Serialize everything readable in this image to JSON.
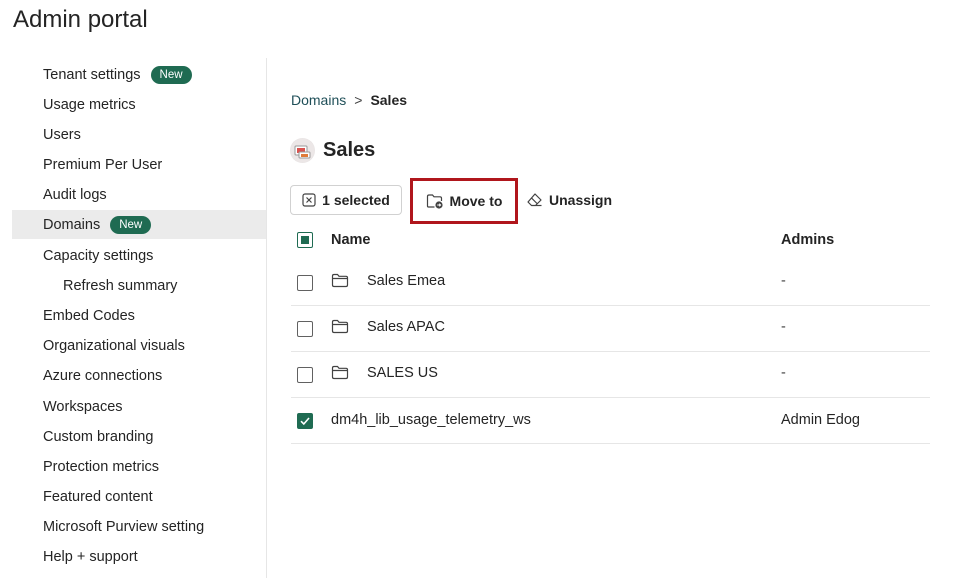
{
  "app": {
    "title": "Admin portal"
  },
  "sidebar": {
    "items": [
      {
        "label": "Tenant settings",
        "badge": "New"
      },
      {
        "label": "Usage metrics"
      },
      {
        "label": "Users"
      },
      {
        "label": "Premium Per User"
      },
      {
        "label": "Audit logs"
      },
      {
        "label": "Domains",
        "badge": "New",
        "active": true
      },
      {
        "label": "Capacity settings"
      },
      {
        "label": "Refresh summary",
        "sub": true
      },
      {
        "label": "Embed Codes"
      },
      {
        "label": "Organizational visuals"
      },
      {
        "label": "Azure connections"
      },
      {
        "label": "Workspaces"
      },
      {
        "label": "Custom branding"
      },
      {
        "label": "Protection metrics"
      },
      {
        "label": "Featured content"
      },
      {
        "label": "Microsoft Purview setting"
      },
      {
        "label": "Help + support"
      }
    ]
  },
  "breadcrumb": {
    "parent": "Domains",
    "separator": ">",
    "current": "Sales"
  },
  "domain": {
    "name": "Sales",
    "icon": "domain-avatar-icon"
  },
  "toolbar": {
    "selected_label": "1 selected",
    "move_label": "Move to",
    "unassign_label": "Unassign",
    "highlight_color": "#b0161c"
  },
  "table": {
    "columns": [
      "Name",
      "Admins"
    ],
    "header_checkbox": "partial",
    "rows": [
      {
        "name": "Sales Emea",
        "admins": "-",
        "type": "folder",
        "checked": false
      },
      {
        "name": "Sales APAC",
        "admins": "-",
        "type": "folder",
        "checked": false
      },
      {
        "name": "SALES US",
        "admins": "-",
        "type": "folder",
        "checked": false
      },
      {
        "name": "dm4h_lib_usage_telemetry_ws",
        "admins": "Admin Edog",
        "type": "workspace",
        "checked": true
      }
    ]
  },
  "colors": {
    "accent": "#1f6b52",
    "active_bg": "#ebebeb"
  }
}
